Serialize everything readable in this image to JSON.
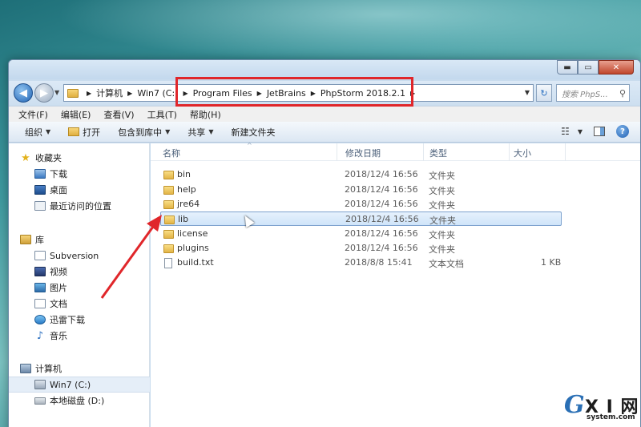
{
  "window": {
    "controls": {
      "minimize": "▬",
      "maximize": "▭",
      "close": "✕"
    }
  },
  "navigation": {
    "back_symbol": "◀",
    "forward_symbol": "▶",
    "history_dropdown": "▼",
    "breadcrumbs": [
      "计算机",
      "Win7 (C:)",
      "Program Files",
      "JetBrains",
      "PhpStorm 2018.2.1"
    ],
    "crumb_separator": "▶",
    "address_dropdown": "▼",
    "refresh_symbol": "↻",
    "search_placeholder": "搜索 PhpS..."
  },
  "menubar": {
    "items": [
      "文件(F)",
      "编辑(E)",
      "查看(V)",
      "工具(T)",
      "帮助(H)"
    ]
  },
  "toolbar": {
    "organize": "组织",
    "open": "打开",
    "include_in_library": "包含到库中",
    "share": "共享",
    "new_folder": "新建文件夹",
    "dropdown_arrow": "▼",
    "view_icon_glyph": "☷",
    "help_glyph": "?"
  },
  "sidebar": {
    "favorites": {
      "label": "收藏夹",
      "items": [
        "下载",
        "桌面",
        "最近访问的位置"
      ]
    },
    "libraries": {
      "label": "库",
      "items": [
        "Subversion",
        "视频",
        "图片",
        "文档",
        "迅雷下载",
        "音乐"
      ]
    },
    "computer": {
      "label": "计算机",
      "items": [
        "Win7 (C:)",
        "本地磁盘 (D:)"
      ]
    }
  },
  "columns": {
    "name": "名称",
    "modified": "修改日期",
    "type": "类型",
    "size": "大小",
    "sort_caret": "^"
  },
  "files": [
    {
      "name": "bin",
      "modified": "2018/12/4 16:56",
      "type": "文件夹",
      "size": "",
      "kind": "folder"
    },
    {
      "name": "help",
      "modified": "2018/12/4 16:56",
      "type": "文件夹",
      "size": "",
      "kind": "folder"
    },
    {
      "name": "jre64",
      "modified": "2018/12/4 16:56",
      "type": "文件夹",
      "size": "",
      "kind": "folder"
    },
    {
      "name": "lib",
      "modified": "2018/12/4 16:56",
      "type": "文件夹",
      "size": "",
      "kind": "folder"
    },
    {
      "name": "license",
      "modified": "2018/12/4 16:56",
      "type": "文件夹",
      "size": "",
      "kind": "folder"
    },
    {
      "name": "plugins",
      "modified": "2018/12/4 16:56",
      "type": "文件夹",
      "size": "",
      "kind": "folder"
    },
    {
      "name": "build.txt",
      "modified": "2018/8/8 15:41",
      "type": "文本文档",
      "size": "1 KB",
      "kind": "text"
    }
  ],
  "annotation": {
    "highlight_color": "#e0262a",
    "arrow_color": "#e0262a"
  },
  "watermark": {
    "logo_g": "G",
    "logo_xi": "X I 网",
    "site": "system.com"
  },
  "colors": {
    "accent": "#2063b4",
    "selection": "#cfe4f9",
    "folder": "#e2b446"
  }
}
